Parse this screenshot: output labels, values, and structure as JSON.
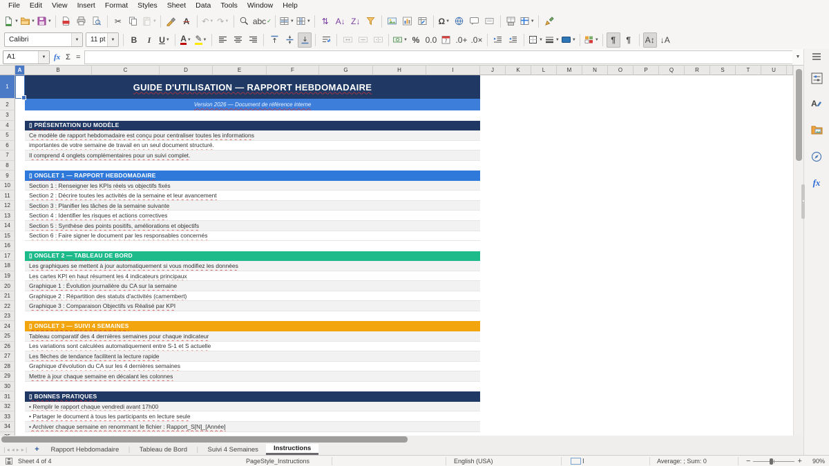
{
  "menu": {
    "items": [
      "File",
      "Edit",
      "View",
      "Insert",
      "Format",
      "Styles",
      "Sheet",
      "Data",
      "Tools",
      "Window",
      "Help"
    ]
  },
  "toolbar": {
    "standard": [
      {
        "icon": "new-document",
        "dropdown": 1
      },
      {
        "icon": "open-file",
        "dropdown": 1
      },
      {
        "icon": "save",
        "dropdown": 1
      },
      {
        "sep": 1
      },
      {
        "icon": "export-pdf"
      },
      {
        "icon": "print"
      },
      {
        "icon": "print-preview"
      },
      {
        "sep": 1
      },
      {
        "icon": "cut"
      },
      {
        "icon": "copy"
      },
      {
        "icon": "paste",
        "dropdown": 1,
        "disabled": 1
      },
      {
        "sep": 1
      },
      {
        "icon": "clone-formatting"
      },
      {
        "icon": "clear-formatting",
        "label": "A"
      },
      {
        "sep": 1
      },
      {
        "icon": "undo",
        "dropdown": 1,
        "disabled": 1
      },
      {
        "icon": "redo",
        "dropdown": 1,
        "disabled": 1
      },
      {
        "sep": 1
      },
      {
        "icon": "find-and-replace"
      },
      {
        "icon": "spelling",
        "label": "abc"
      },
      {
        "sep": 1
      },
      {
        "icon": "insert-rows",
        "dropdown": 1
      },
      {
        "icon": "insert-columns",
        "dropdown": 1
      },
      {
        "sep": 1
      },
      {
        "icon": "sort"
      },
      {
        "icon": "sort-ascending",
        "label": "A↓"
      },
      {
        "icon": "sort-descending",
        "label": "Z↓"
      },
      {
        "icon": "autofilter"
      },
      {
        "sep": 1
      },
      {
        "icon": "insert-image"
      },
      {
        "icon": "insert-chart"
      },
      {
        "icon": "insert-pivot-table"
      },
      {
        "sep": 1
      },
      {
        "icon": "special-character",
        "label": "Ω",
        "dropdown": 1
      },
      {
        "icon": "insert-hyperlink"
      },
      {
        "icon": "insert-comment"
      },
      {
        "icon": "insert-text-box"
      },
      {
        "sep": 1
      },
      {
        "icon": "define-print-area"
      },
      {
        "icon": "freeze-rows-columns",
        "dropdown": 1
      },
      {
        "sep": 1
      },
      {
        "icon": "show-draw-functions"
      }
    ],
    "formatting": [
      {
        "combo": "font-name",
        "value": "Calibri"
      },
      {
        "combo": "font-size",
        "value": "11 pt"
      },
      {
        "sep": 1
      },
      {
        "icon": "bold",
        "label": "B"
      },
      {
        "icon": "italic",
        "label": "I"
      },
      {
        "icon": "underline",
        "label": "U",
        "dropdown": 1
      },
      {
        "sep": 1
      },
      {
        "icon": "font-color",
        "label": "A",
        "dropdown": 1
      },
      {
        "icon": "highlighting-color",
        "dropdown": 1
      },
      {
        "sep": 1
      },
      {
        "icon": "align-left"
      },
      {
        "icon": "align-center"
      },
      {
        "icon": "align-right"
      },
      {
        "sep": 1
      },
      {
        "icon": "align-top"
      },
      {
        "icon": "center-vertically"
      },
      {
        "icon": "align-bottom",
        "pressed": 1
      },
      {
        "sep": 1
      },
      {
        "icon": "wrap-text"
      },
      {
        "sep": 1
      },
      {
        "icon": "merge-and-center",
        "disabled": 1
      },
      {
        "icon": "merge-cells",
        "disabled": 1
      },
      {
        "icon": "unmerge-cells",
        "disabled": 1
      },
      {
        "sep": 1
      },
      {
        "icon": "format-currency",
        "dropdown": 1
      },
      {
        "icon": "format-percent",
        "label": "%"
      },
      {
        "icon": "format-number",
        "label": "0.0"
      },
      {
        "icon": "format-date"
      },
      {
        "icon": "add-decimal",
        "label": ".0+"
      },
      {
        "icon": "delete-decimal",
        "label": ".0×"
      },
      {
        "sep": 1
      },
      {
        "icon": "increase-indent"
      },
      {
        "icon": "decrease-indent"
      },
      {
        "sep": 1
      },
      {
        "icon": "borders",
        "dropdown": 1
      },
      {
        "icon": "border-style",
        "dropdown": 1
      },
      {
        "icon": "background-color",
        "dropdown": 1
      },
      {
        "sep": 1
      },
      {
        "icon": "conditional-formatting",
        "dropdown": 1
      },
      {
        "sep": 1
      },
      {
        "icon": "left-to-right",
        "label": "¶",
        "pressed": 1
      },
      {
        "icon": "right-to-left",
        "label": "¶"
      },
      {
        "sep": 1
      },
      {
        "icon": "text-direction-vertical",
        "label": "A↕",
        "pressed": 1
      },
      {
        "icon": "rotate-text",
        "label": "↓A"
      }
    ]
  },
  "formula_bar": {
    "cell_reference": "A1",
    "function_labels": [
      "fx",
      "Σ",
      "="
    ],
    "formula_value": ""
  },
  "grid": {
    "columns": [
      "A",
      "B",
      "C",
      "D",
      "E",
      "F",
      "G",
      "H",
      "I",
      "J",
      "K",
      "L",
      "M",
      "N",
      "O",
      "P",
      "Q",
      "R",
      "S",
      "T",
      "U"
    ],
    "selected_column": "A",
    "selected_row": "1",
    "rows": [
      {
        "num": 1,
        "kind": "title",
        "color_key": "title_bg",
        "text": "GUIDE D'UTILISATION — RAPPORT HEBDOMADAIRE"
      },
      {
        "num": 2,
        "kind": "subtitle",
        "color_key": "subtitle_bg",
        "text": "Version 2026 — Document de référence interne"
      },
      {
        "num": 3,
        "kind": "blank",
        "text": ""
      },
      {
        "num": 4,
        "kind": "section",
        "color_key": "navy",
        "text": "▯ PRÉSENTATION DU MODÈLE"
      },
      {
        "num": 5,
        "kind": "item",
        "text": "Ce modèle de rapport hebdomadaire est conçu pour centraliser toutes les informations"
      },
      {
        "num": 6,
        "kind": "item",
        "text": "importantes de votre semaine de travail en un seul document structuré."
      },
      {
        "num": 7,
        "kind": "item",
        "text": "Il comprend 4 onglets complémentaires pour un suivi complet."
      },
      {
        "num": 8,
        "kind": "blank",
        "text": ""
      },
      {
        "num": 9,
        "kind": "section",
        "color_key": "blue",
        "text": "▯ ONGLET 1 — RAPPORT HEBDOMADAIRE"
      },
      {
        "num": 10,
        "kind": "item",
        "text": "Section 1 : Renseigner les KPIs réels vs objectifs fixés"
      },
      {
        "num": 11,
        "kind": "item",
        "text": "Section 2 : Décrire toutes les activités de la semaine et leur avancement"
      },
      {
        "num": 12,
        "kind": "item",
        "text": "Section 3 : Planifier les tâches de la semaine suivante"
      },
      {
        "num": 13,
        "kind": "item",
        "text": "Section 4 : Identifier les risques et actions correctives"
      },
      {
        "num": 14,
        "kind": "item",
        "text": "Section 5 : Synthèse des points positifs, améliorations et objectifs"
      },
      {
        "num": 15,
        "kind": "item",
        "text": "Section 6 : Faire signer le document par les responsables concernés"
      },
      {
        "num": 16,
        "kind": "blank",
        "text": ""
      },
      {
        "num": 17,
        "kind": "section",
        "color_key": "green",
        "text": "▯ ONGLET 2 — TABLEAU DE BORD"
      },
      {
        "num": 18,
        "kind": "item",
        "text": "Les graphiques se mettent à jour automatiquement si vous modifiez les données"
      },
      {
        "num": 19,
        "kind": "item",
        "text": "Les cartes KPI en haut résument les 4 indicateurs principaux"
      },
      {
        "num": 20,
        "kind": "item",
        "text": "Graphique 1 : Évolution journalière du CA sur la semaine"
      },
      {
        "num": 21,
        "kind": "item",
        "text": "Graphique 2 : Répartition des statuts d'activités (camembert)"
      },
      {
        "num": 22,
        "kind": "item",
        "text": "Graphique 3 : Comparaison Objectifs vs Réalisé par KPI"
      },
      {
        "num": 23,
        "kind": "blank",
        "text": ""
      },
      {
        "num": 24,
        "kind": "section",
        "color_key": "orange",
        "text": "▯ ONGLET 3 — SUIVI 4 SEMAINES"
      },
      {
        "num": 25,
        "kind": "item",
        "text": "Tableau comparatif des 4 dernières semaines pour chaque indicateur"
      },
      {
        "num": 26,
        "kind": "item",
        "text": "Les variations sont calculées automatiquement entre S-1 et S actuelle"
      },
      {
        "num": 27,
        "kind": "item",
        "text": "Les flèches de tendance facilitent la lecture rapide"
      },
      {
        "num": 28,
        "kind": "item",
        "text": "Graphique d'évolution du CA sur les 4 dernières semaines"
      },
      {
        "num": 29,
        "kind": "item",
        "text": "Mettre à jour chaque semaine en décalant les colonnes"
      },
      {
        "num": 30,
        "kind": "blank",
        "text": ""
      },
      {
        "num": 31,
        "kind": "section",
        "color_key": "navy",
        "text": "▯ BONNES PRATIQUES"
      },
      {
        "num": 32,
        "kind": "item",
        "text": "• Remplir le rapport chaque vendredi avant 17h00"
      },
      {
        "num": 33,
        "kind": "item",
        "text": "• Partager le document à tous les participants en lecture seule"
      },
      {
        "num": 34,
        "kind": "item",
        "text": "• Archiver chaque semaine en renommant le fichier : Rapport_S[N]_[Année]"
      },
      {
        "num": 35,
        "kind": "blank",
        "text": ""
      }
    ]
  },
  "colors": {
    "title_bg": "#1F3864",
    "subtitle_bg": "#3D7EDB",
    "navy": "#1F3864",
    "blue": "#2E79D9",
    "green": "#1DBA8A",
    "orange": "#F2A50C",
    "stripe": "#F2F2F2",
    "selection": "#3E6FC1",
    "font_color_red": "#C00000",
    "highlight_yellow": "#FFE800",
    "background_fill_blue": "#2E75B6"
  },
  "sheet_tabs": {
    "tabs": [
      {
        "label": "Rapport Hebdomadaire",
        "active": false
      },
      {
        "label": "Tableau de Bord",
        "active": false
      },
      {
        "label": "Suivi 4 Semaines",
        "active": false
      },
      {
        "label": "Instructions",
        "active": true
      }
    ]
  },
  "status_bar": {
    "sheet_info": "Sheet 4 of 4",
    "page_style": "PageStyle_Instructions",
    "language": "English (USA)",
    "stats": "Average: ; Sum: 0",
    "zoom_level": "90%"
  },
  "sidebar": {
    "icons": [
      "sidebar-menu-icon",
      "properties-icon",
      "styles-icon",
      "gallery-icon",
      "navigator-icon",
      "functions-icon"
    ]
  }
}
